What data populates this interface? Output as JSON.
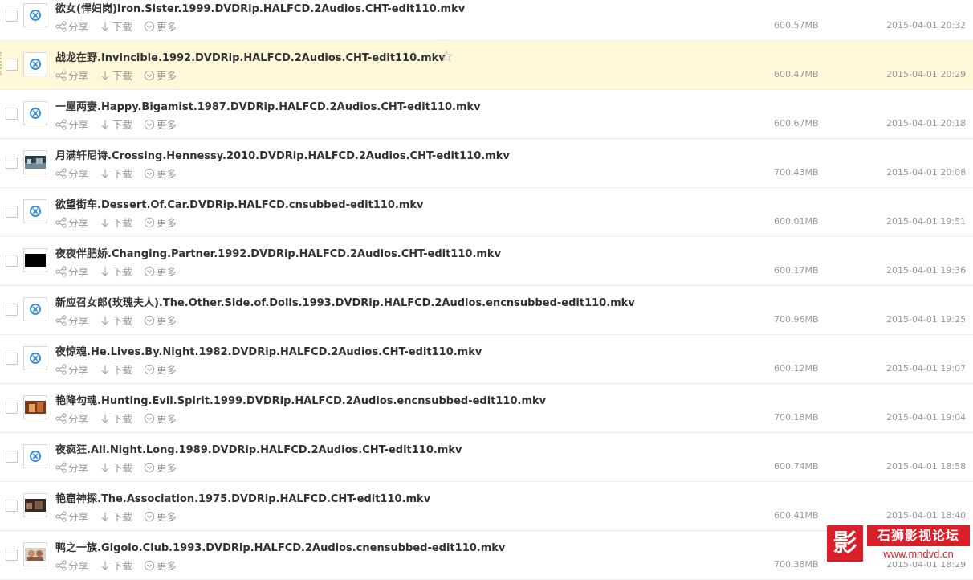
{
  "actions": {
    "share": "分享",
    "download": "下载",
    "more": "更多"
  },
  "colors": {
    "text": "#333333",
    "meta": "#999999",
    "highlight_bg": "#fff9d9",
    "video_icon": "#3d8fd6",
    "watermark": "#d9202a"
  },
  "files": [
    {
      "name": "欲女(悍妇岗)Iron.Sister.1999.DVDRip.HALFCD.2Audios.CHT-edit110.mkv",
      "size": "600.57MB",
      "date": "2015-04-01 20:32",
      "thumb": "video-icon",
      "highlighted": false
    },
    {
      "name": "战龙在野.Invincible.1992.DVDRip.HALFCD.2Audios.CHT-edit110.mkv",
      "size": "600.47MB",
      "date": "2015-04-01 20:29",
      "thumb": "video-icon",
      "highlighted": true
    },
    {
      "name": "一屋两妻.Happy.Bigamist.1987.DVDRip.HALFCD.2Audios.CHT-edit110.mkv",
      "size": "600.67MB",
      "date": "2015-04-01 20:18",
      "thumb": "video-icon",
      "highlighted": false
    },
    {
      "name": "月满轩尼诗.Crossing.Hennessy.2010.DVDRip.HALFCD.2Audios.CHT-edit110.mkv",
      "size": "700.43MB",
      "date": "2015-04-01 20:08",
      "thumb": "photo-night",
      "highlighted": false
    },
    {
      "name": "欲望街车.Dessert.Of.Car.DVDRip.HALFCD.cnsubbed-edit110.mkv",
      "size": "600.01MB",
      "date": "2015-04-01 19:51",
      "thumb": "video-icon",
      "highlighted": false
    },
    {
      "name": "夜夜伴肥娇.Changing.Partner.1992.DVDRip.HALFCD.2Audios.CHT-edit110.mkv",
      "size": "600.17MB",
      "date": "2015-04-01 19:36",
      "thumb": "photo-black",
      "highlighted": false
    },
    {
      "name": "新应召女郎(玫瑰夫人).The.Other.Side.of.Dolls.1993.DVDRip.HALFCD.2Audios.encnsubbed-edit110.mkv",
      "size": "700.96MB",
      "date": "2015-04-01 19:25",
      "thumb": "video-icon",
      "highlighted": false
    },
    {
      "name": "夜惊魂.He.Lives.By.Night.1982.DVDRip.HALFCD.2Audios.CHT-edit110.mkv",
      "size": "600.12MB",
      "date": "2015-04-01 19:07",
      "thumb": "video-icon",
      "highlighted": false
    },
    {
      "name": "艳降勾魂.Hunting.Evil.Spirit.1999.DVDRip.HALFCD.2Audios.encnsubbed-edit110.mkv",
      "size": "700.18MB",
      "date": "2015-04-01 19:04",
      "thumb": "photo-warm",
      "highlighted": false
    },
    {
      "name": "夜疯狂.All.Night.Long.1989.DVDRip.HALFCD.2Audios.CHT-edit110.mkv",
      "size": "600.74MB",
      "date": "2015-04-01 18:58",
      "thumb": "video-icon",
      "highlighted": false
    },
    {
      "name": "艳窟神探.The.Association.1975.DVDRip.HALFCD.CHT-edit110.mkv",
      "size": "600.41MB",
      "date": "2015-04-01 18:40",
      "thumb": "photo-dark",
      "highlighted": false
    },
    {
      "name": "鸭之一族.Gigolo.Club.1993.DVDRip.HALFCD.2Audios.cnensubbed-edit110.mkv",
      "size": "700.38MB",
      "date": "2015-04-01 18:29",
      "thumb": "photo-people",
      "highlighted": false
    }
  ],
  "watermark": {
    "glyph": "影",
    "title": "石狮影视论坛",
    "url": "www.mndvd.cn"
  }
}
